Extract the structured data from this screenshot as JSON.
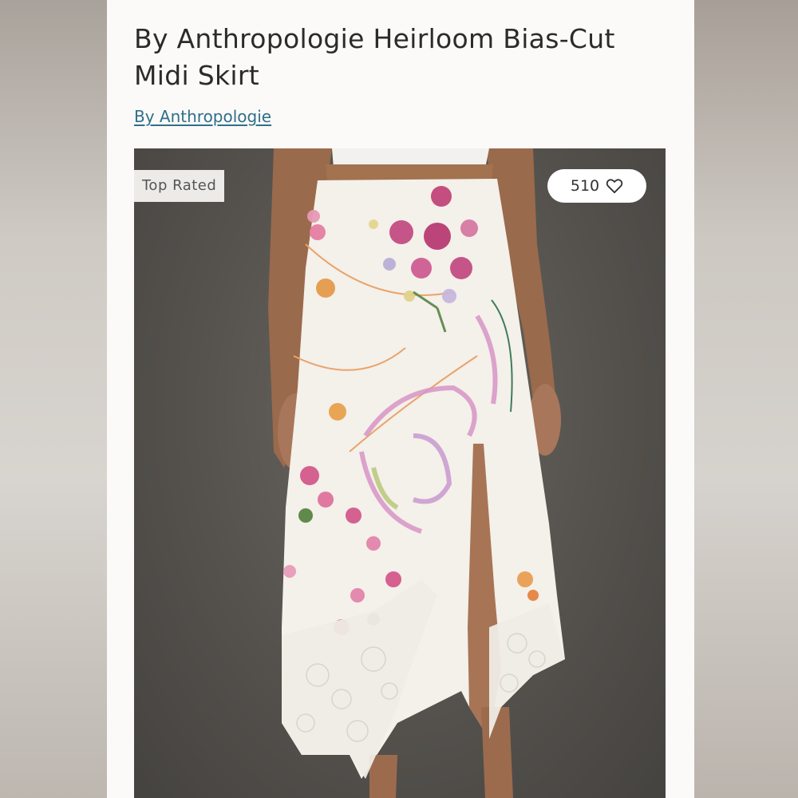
{
  "product": {
    "title": "By Anthropologie Heirloom Bias-Cut Midi Skirt",
    "brand_link": "By Anthropologie"
  },
  "image": {
    "badge": "Top Rated",
    "like_count": "510",
    "like_icon": "heart-outline-icon"
  },
  "colors": {
    "link": "#2f6f8a",
    "title": "#2b2b2b",
    "background": "#fbfaf8"
  }
}
